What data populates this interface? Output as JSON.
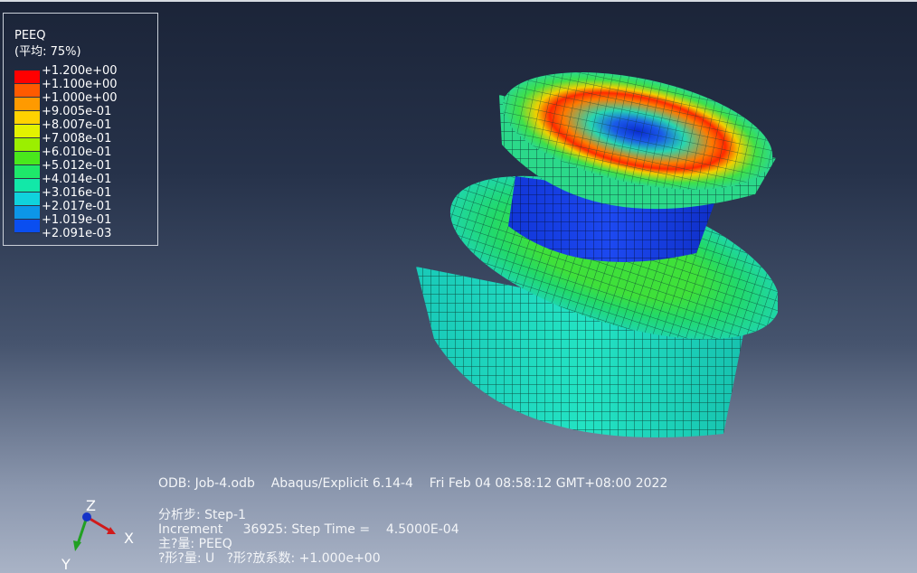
{
  "legend": {
    "title": "PEEQ",
    "subtitle": "(平均: 75%)",
    "levels": [
      {
        "label": "+1.200e+00",
        "color": "#ff0000"
      },
      {
        "label": "+1.100e+00",
        "color": "#ff5a00"
      },
      {
        "label": "+1.000e+00",
        "color": "#ff9a00"
      },
      {
        "label": "+9.005e-01",
        "color": "#ffd200"
      },
      {
        "label": "+8.007e-01",
        "color": "#e3f200"
      },
      {
        "label": "+7.008e-01",
        "color": "#9bef00"
      },
      {
        "label": "+6.010e-01",
        "color": "#49e81c"
      },
      {
        "label": "+5.012e-01",
        "color": "#1ee86a"
      },
      {
        "label": "+4.014e-01",
        "color": "#12e8a8"
      },
      {
        "label": "+3.016e-01",
        "color": "#10d2dc"
      },
      {
        "label": "+2.017e-01",
        "color": "#0c96e8"
      },
      {
        "label": "+1.019e-01",
        "color": "#0a4ef0"
      },
      {
        "label": "+2.091e-03",
        "color": "#0a1eda"
      }
    ]
  },
  "info": {
    "odb_line": "ODB: Job-4.odb    Abaqus/Explicit 6.14-4    Fri Feb 04 08:58:12 GMT+08:00 2022",
    "step_line": "分析步: Step-1",
    "increment_line": "Increment     36925: Step Time =    4.5000E-04",
    "primary_line": "主?量: PEEQ",
    "deformed_line": "?形?量: U   ?形?放系数: +1.000e+00"
  },
  "triad": {
    "x_label": "X",
    "y_label": "Y",
    "z_label": "Z"
  }
}
